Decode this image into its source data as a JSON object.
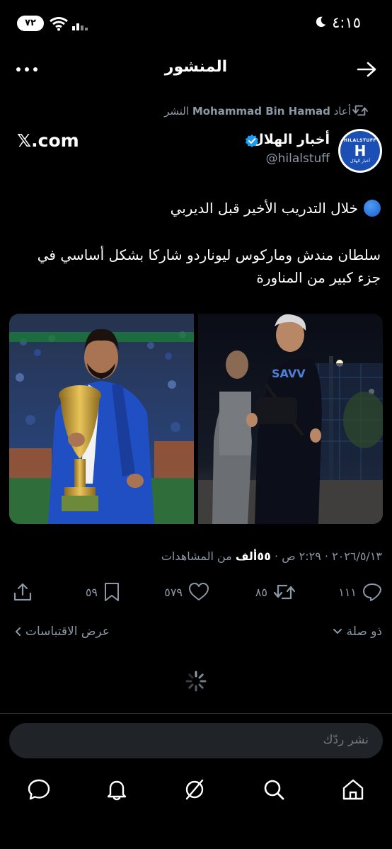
{
  "status": {
    "time": "٤:١٥",
    "battery": "٧٢"
  },
  "nav": {
    "title": "المنشور"
  },
  "repost": {
    "user": "Mohammad Bin Hamad",
    "prefix": "أعاد",
    "suffix": "النشر"
  },
  "author": {
    "name": "أخبار الهلال",
    "handle": "@hilalstuff",
    "avatar_text_top": "HILALSTUFF",
    "avatar_text_bottom": "أخبار الهلال",
    "source": "𝕏.com"
  },
  "tweet": {
    "line1": "خلال التدريب الأخير قبل الديربي",
    "body": "سلطان مندش وماركوس ليوناردو شاركا بشكل أساسي في جزء كبير من المناورة"
  },
  "meta": {
    "date": "٢٠٢٦/٥/١٣",
    "time": "٢:٢٩ ص",
    "views_count": "٥٥ألف",
    "views_label": "من المشاهدات"
  },
  "actions": {
    "replies": "١١١",
    "reposts": "٨٥",
    "likes": "٥٧٩",
    "bookmarks": "٥٩"
  },
  "links": {
    "relevant": "ذو صلة",
    "quotes": "عرض الاقتباسات"
  },
  "reply": {
    "placeholder": "نشر ردّك"
  },
  "colors": {
    "background": "#000000",
    "text": "#e7e9ea",
    "muted": "#8b98a5",
    "verified": "#1d9bf0",
    "input_bg": "#202327"
  }
}
